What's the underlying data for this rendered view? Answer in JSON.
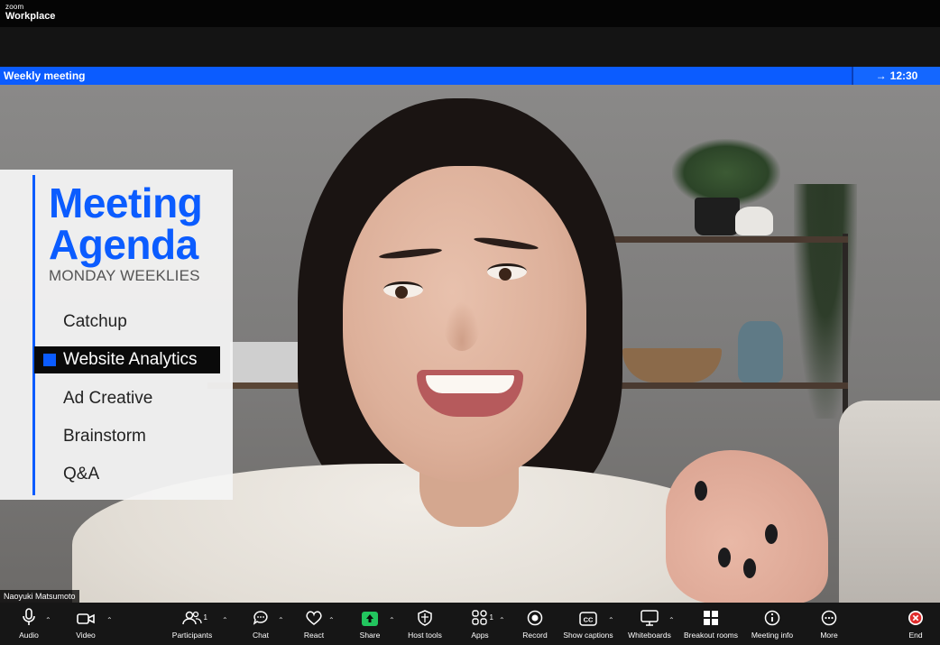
{
  "app": {
    "brand_small": "zoom",
    "brand_large": "Workplace"
  },
  "banner": {
    "title": "Weekly meeting",
    "timer": "12:30"
  },
  "agenda": {
    "title_line1": "Meeting",
    "title_line2": "Agenda",
    "subtitle": "MONDAY WEEKLIES",
    "items": [
      {
        "label": "Catchup",
        "active": false
      },
      {
        "label": "Website Analytics",
        "active": true
      },
      {
        "label": "Ad Creative",
        "active": false
      },
      {
        "label": "Brainstorm",
        "active": false
      },
      {
        "label": "Q&A",
        "active": false
      }
    ],
    "accent_color": "#0b5cff"
  },
  "participant": {
    "name": "Naoyuki Matsumoto"
  },
  "toolbar": {
    "audio": "Audio",
    "video": "Video",
    "participants": "Participants",
    "participants_count": "1",
    "chat": "Chat",
    "react": "React",
    "share": "Share",
    "host_tools": "Host tools",
    "apps": "Apps",
    "apps_count": "1",
    "record": "Record",
    "show_captions": "Show captions",
    "whiteboards": "Whiteboards",
    "breakout_rooms": "Breakout rooms",
    "meeting_info": "Meeting info",
    "more": "More",
    "end": "End"
  },
  "colors": {
    "share_green": "#22c55e",
    "end_red": "#e02d2d",
    "banner_blue": "#0b5cff"
  }
}
